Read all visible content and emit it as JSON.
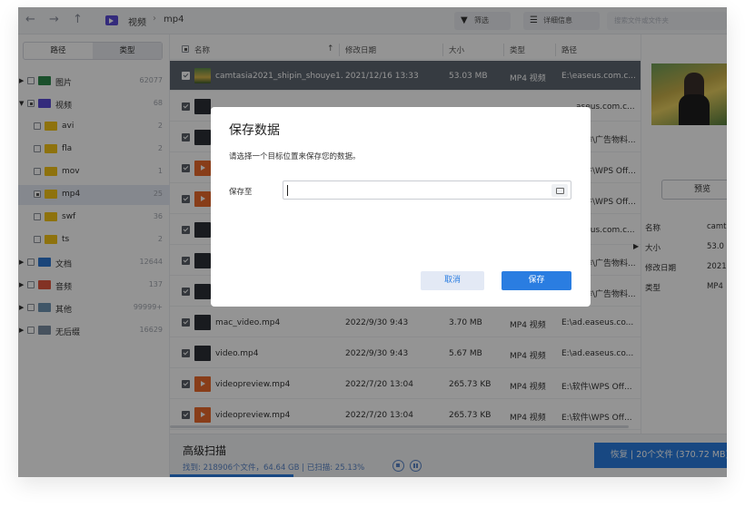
{
  "topbar": {
    "breadcrumb_root": "视频",
    "breadcrumb_current": "mp4",
    "filter_label": "筛选",
    "details_label": "详细信息",
    "search_placeholder": "搜索文件或文件夹"
  },
  "sidebar": {
    "tabs": [
      "路径",
      "类型"
    ],
    "items": [
      {
        "label": "图片",
        "count": "62077",
        "icon": "picture-folder-icon"
      },
      {
        "label": "视频",
        "count": "68",
        "icon": "video-folder-icon"
      },
      {
        "label": "avi",
        "count": "2",
        "icon": "folder-icon"
      },
      {
        "label": "fla",
        "count": "2",
        "icon": "folder-icon"
      },
      {
        "label": "mov",
        "count": "1",
        "icon": "folder-icon"
      },
      {
        "label": "mp4",
        "count": "25",
        "icon": "folder-icon"
      },
      {
        "label": "swf",
        "count": "36",
        "icon": "folder-icon"
      },
      {
        "label": "ts",
        "count": "2",
        "icon": "folder-icon"
      },
      {
        "label": "文档",
        "count": "12644",
        "icon": "document-folder-icon"
      },
      {
        "label": "音频",
        "count": "137",
        "icon": "audio-folder-icon"
      },
      {
        "label": "其他",
        "count": "99999+",
        "icon": "other-folder-icon"
      },
      {
        "label": "无后缀",
        "count": "16629",
        "icon": "no-extension-folder-icon"
      }
    ]
  },
  "filelist": {
    "columns": [
      "名称",
      "修改日期",
      "大小",
      "类型",
      "路径"
    ],
    "rows": [
      {
        "name": "camtasia2021_shipin_shouye1....",
        "date": "2021/12/16 13:33",
        "size": "53.03 MB",
        "type": "MP4 视频",
        "path": "E:\\easeus.com.c..."
      },
      {
        "name": "",
        "date": "",
        "size": "",
        "type": "",
        "path": "aseus.com.c..."
      },
      {
        "name": "",
        "date": "",
        "size": "",
        "type": "",
        "path": "工作\\广告物料..."
      },
      {
        "name": "",
        "date": "",
        "size": "",
        "type": "",
        "path": "软件\\WPS Off..."
      },
      {
        "name": "",
        "date": "",
        "size": "",
        "type": "",
        "path": "软件\\WPS Off..."
      },
      {
        "name": "",
        "date": "",
        "size": "",
        "type": "",
        "path": "aseus.com.c..."
      },
      {
        "name": "",
        "date": "",
        "size": "",
        "type": "",
        "path": "工作\\广告物料..."
      },
      {
        "name": "",
        "date": "",
        "size": "",
        "type": "",
        "path": "工作\\广告物料..."
      },
      {
        "name": "mac_video.mp4",
        "date": "2022/9/30 9:43",
        "size": "3.70 MB",
        "type": "MP4 视频",
        "path": "E:\\ad.easeus.co..."
      },
      {
        "name": "video.mp4",
        "date": "2022/9/30 9:43",
        "size": "5.67 MB",
        "type": "MP4 视频",
        "path": "E:\\ad.easeus.co..."
      },
      {
        "name": "videopreview.mp4",
        "date": "2022/7/20 13:04",
        "size": "265.73 KB",
        "type": "MP4 视频",
        "path": "E:\\软件\\WPS Off..."
      },
      {
        "name": "videopreview.mp4",
        "date": "2022/7/20 13:04",
        "size": "265.73 KB",
        "type": "MP4 视频",
        "path": "E:\\软件\\WPS Off..."
      }
    ]
  },
  "right_panel": {
    "preview_button": "预览",
    "info": [
      {
        "key": "名称",
        "value": "camt"
      },
      {
        "key": "大小",
        "value": "53.0"
      },
      {
        "key": "修改日期",
        "value": "2021"
      },
      {
        "key": "类型",
        "value": "MP4"
      }
    ]
  },
  "footer": {
    "title": "高级扫描",
    "status": "找到: 218906个文件，64.64 GB | 已扫描: 25.13%",
    "scan_progress": 0.2513,
    "recover_label": "恢复 | 20个文件 (370.72 MB)"
  },
  "dialog": {
    "title": "保存数据",
    "subtitle": "请选择一个目标位置来保存您的数据。",
    "save_to_label": "保存至",
    "path_value": "",
    "cancel_label": "取消",
    "save_label": "保存"
  },
  "colors": {
    "accent": "#2a7de1",
    "selected_row": "#5e6671",
    "overlay": "rgba(0,0,0,0.42)"
  }
}
